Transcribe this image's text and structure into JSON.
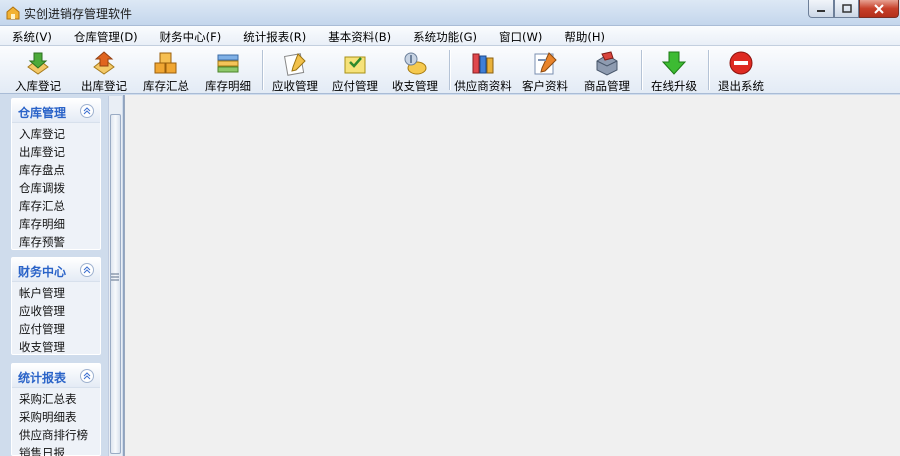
{
  "window": {
    "title": "实创进销存管理软件"
  },
  "menu": [
    "系统(V)",
    "仓库管理(D)",
    "财务中心(F)",
    "统计报表(R)",
    "基本资料(B)",
    "系统功能(G)",
    "窗口(W)",
    "帮助(H)"
  ],
  "toolbar": {
    "in_stock": "入库登记",
    "out_stock": "出库登记",
    "stock_summary": "库存汇总",
    "stock_detail": "库存明细",
    "receivable": "应收管理",
    "payable": "应付管理",
    "cash": "收支管理",
    "supplier": "供应商资料",
    "customer": "客户资料",
    "goods": "商品管理",
    "upgrade": "在线升级",
    "exit": "退出系统"
  },
  "sidebar": {
    "groups": [
      {
        "title": "仓库管理",
        "items": [
          "入库登记",
          "出库登记",
          "库存盘点",
          "仓库调拨",
          "库存汇总",
          "库存明细",
          "库存预警"
        ]
      },
      {
        "title": "财务中心",
        "items": [
          "帐户管理",
          "应收管理",
          "应付管理",
          "收支管理"
        ]
      },
      {
        "title": "统计报表",
        "items": [
          "采购汇总表",
          "采购明细表",
          "供应商排行榜",
          "销售日报"
        ]
      }
    ]
  },
  "colors": {
    "accent": "#2a63c8",
    "workarea": "#f0f0f0",
    "panel": "#cfdcec"
  }
}
